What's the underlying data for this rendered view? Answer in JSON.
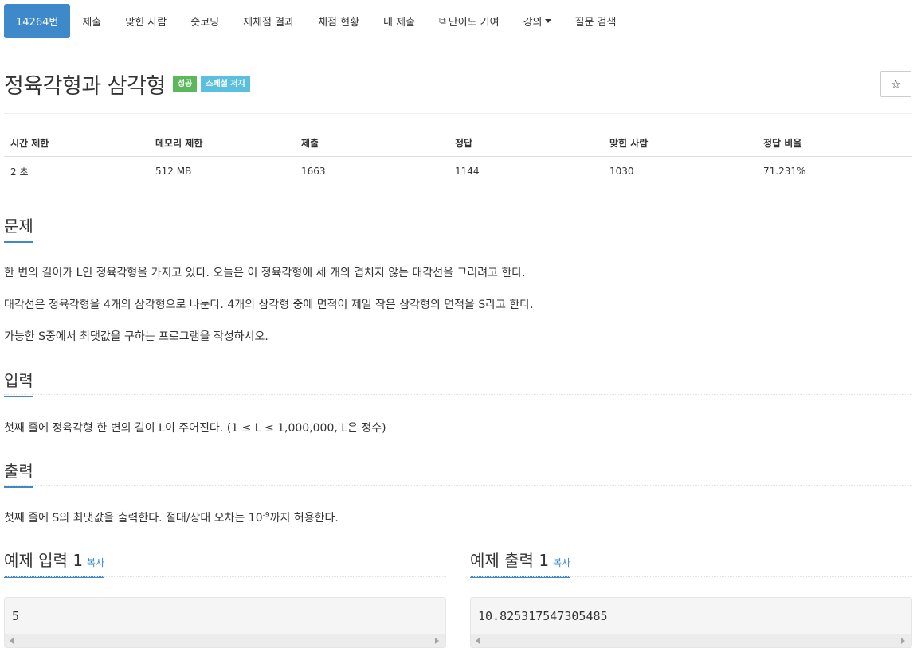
{
  "nav": {
    "items": [
      {
        "label": "14264번",
        "active": true
      },
      {
        "label": "제출"
      },
      {
        "label": "맞힌 사람"
      },
      {
        "label": "숏코딩"
      },
      {
        "label": "재채점 결과"
      },
      {
        "label": "채점 현황"
      },
      {
        "label": "내 제출"
      },
      {
        "label": "난이도 기여",
        "icon": "external-link-icon"
      },
      {
        "label": "강의",
        "dropdown": true
      },
      {
        "label": "질문 검색"
      }
    ],
    "icon_glyph": "⧉"
  },
  "problem": {
    "title": "정육각형과 삼각형",
    "badges": {
      "success": "성공",
      "special_judge": "스페셜 저지"
    },
    "star_icon": "☆"
  },
  "info_table": {
    "headers": [
      "시간 제한",
      "메모리 제한",
      "제출",
      "정답",
      "맞힌 사람",
      "정답 비율"
    ],
    "values": [
      "2 초",
      "512 MB",
      "1663",
      "1144",
      "1030",
      "71.231%"
    ]
  },
  "sections": {
    "problem_heading": "문제",
    "problem_lines": [
      "한 변의 길이가 L인 정육각형을 가지고 있다. 오늘은 이 정육각형에 세 개의 겹치지 않는 대각선을 그리려고 한다.",
      "대각선은 정육각형을 4개의 삼각형으로 나눈다. 4개의 삼각형 중에 면적이 제일 작은 삼각형의 면적을 S라고 한다.",
      "가능한 S중에서 최댓값을 구하는 프로그램을 작성하시오."
    ],
    "input_heading": "입력",
    "input_text": "첫째 줄에 정육각형 한 변의 길이 L이 주어진다. (1 ≤ L ≤ 1,000,000, L은 정수)",
    "output_heading": "출력",
    "output_before": "첫째 줄에 S의 최댓값을 출력한다. 절대/상대 오차는 10",
    "output_sup": "-9",
    "output_after": "까지 허용한다."
  },
  "samples": {
    "input": {
      "heading": "예제 입력 1",
      "copy": "복사",
      "value": "5"
    },
    "output": {
      "heading": "예제 출력 1",
      "copy": "복사",
      "value": "10.825317547305485"
    }
  },
  "colors": {
    "accent": "#3e89c9",
    "success": "#5cb85c",
    "info": "#5bc0de"
  }
}
